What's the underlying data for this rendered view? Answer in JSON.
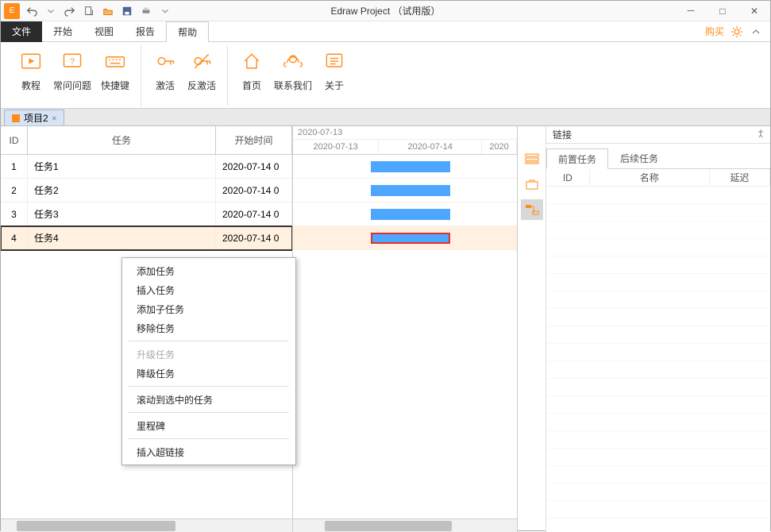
{
  "app": {
    "title": "Edraw Project （试用版）"
  },
  "qat": [
    "undo",
    "redo",
    "new",
    "open",
    "save",
    "print"
  ],
  "menu": {
    "file": "文件",
    "items": [
      "开始",
      "视图",
      "报告",
      "帮助"
    ],
    "selected_index": 3,
    "buy": "购买"
  },
  "ribbon": {
    "groups": [
      {
        "buttons": [
          {
            "label": "教程",
            "icon": "tutorial"
          },
          {
            "label": "常问问题",
            "icon": "faq"
          },
          {
            "label": "快捷键",
            "icon": "shortcut"
          }
        ]
      },
      {
        "buttons": [
          {
            "label": "激活",
            "icon": "activate"
          },
          {
            "label": "反激活",
            "icon": "deactivate"
          }
        ]
      },
      {
        "buttons": [
          {
            "label": "首页",
            "icon": "home"
          },
          {
            "label": "联系我们",
            "icon": "contact"
          },
          {
            "label": "关于",
            "icon": "about"
          }
        ]
      }
    ]
  },
  "doc_tab": {
    "label": "项目2"
  },
  "task_table": {
    "headers": {
      "id": "ID",
      "name": "任务",
      "start": "开始时间"
    },
    "rows": [
      {
        "id": "1",
        "name": "任务1",
        "start": "2020-07-14 0"
      },
      {
        "id": "2",
        "name": "任务2",
        "start": "2020-07-14 0"
      },
      {
        "id": "3",
        "name": "任务3",
        "start": "2020-07-14 0"
      },
      {
        "id": "4",
        "name": "任务4",
        "start": "2020-07-14 0"
      }
    ],
    "selected_index": 3
  },
  "gantt": {
    "scale_label": "2020-07-13",
    "cols": [
      "2020-07-13",
      "2020-07-14",
      "2020"
    ]
  },
  "right_panel": {
    "title": "链接",
    "tabs": [
      "前置任务",
      "后续任务"
    ],
    "active_tab": 0,
    "columns": [
      "ID",
      "名称",
      "延迟"
    ]
  },
  "context_menu": [
    {
      "label": "添加任务",
      "type": "item"
    },
    {
      "label": "插入任务",
      "type": "item"
    },
    {
      "label": "添加子任务",
      "type": "item"
    },
    {
      "label": "移除任务",
      "type": "item"
    },
    {
      "type": "sep"
    },
    {
      "label": "升级任务",
      "type": "item",
      "disabled": true
    },
    {
      "label": "降级任务",
      "type": "item"
    },
    {
      "type": "sep"
    },
    {
      "label": "滚动到选中的任务",
      "type": "item"
    },
    {
      "type": "sep"
    },
    {
      "label": "里程碑",
      "type": "item"
    },
    {
      "type": "sep"
    },
    {
      "label": "插入超链接",
      "type": "item"
    }
  ]
}
